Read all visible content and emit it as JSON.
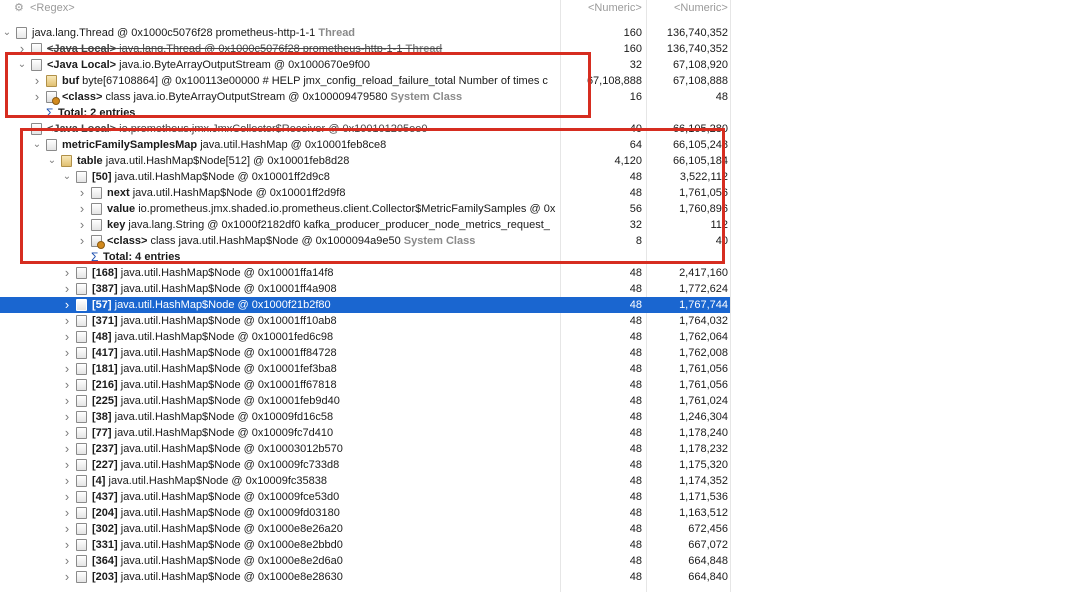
{
  "header": {
    "name_filter": "<Regex>",
    "col1_filter": "<Numeric>",
    "col2_filter": "<Numeric>"
  },
  "rows": [
    {
      "indent": 0,
      "twisty": "v",
      "icon": "thr",
      "bold": "",
      "text": "java.lang.Thread @ 0x1000c5076f28  prometheus-http-1-1",
      "suffix": "Thread",
      "n1": "160",
      "n2": "136,740,352"
    },
    {
      "indent": 1,
      "twisty": ">",
      "icon": "doc",
      "bold": "<Java Local>",
      "text": "java.lang.Thread @ 0x1000c5076f28  prometheus-http-1-1",
      "suffix": "Thread",
      "n1": "160",
      "n2": "136,740,352",
      "strike": true
    },
    {
      "indent": 1,
      "twisty": "v",
      "icon": "doc",
      "bold": "<Java Local>",
      "text": "java.io.ByteArrayOutputStream @ 0x1000670e9f00",
      "suffix": "",
      "n1": "32",
      "n2": "67,108,920"
    },
    {
      "indent": 2,
      "twisty": ">",
      "icon": "arr",
      "bold": "buf",
      "text": "byte[67108864] @ 0x100113e00000  # HELP jmx_config_reload_failure_total Number of times c",
      "suffix": "",
      "n1": "67,108,888",
      "n2": "67,108,888"
    },
    {
      "indent": 2,
      "twisty": ">",
      "icon": "cls",
      "bold": "<class>",
      "text": "class java.io.ByteArrayOutputStream @ 0x100009479580",
      "suffix": "System Class",
      "n1": "16",
      "n2": "48"
    },
    {
      "indent": 2,
      "twisty": "",
      "icon": "sigma",
      "bold": "Total: 2 entries",
      "text": "",
      "suffix": "",
      "n1": "",
      "n2": ""
    },
    {
      "indent": 1,
      "twisty": "v",
      "icon": "doc",
      "bold": "<Java Local>",
      "text": "io.prometheus.jmx.JmxCollector$Receiver @ 0x100101205ee0",
      "suffix": "",
      "n1": "40",
      "n2": "66,105,280",
      "strike": true
    },
    {
      "indent": 2,
      "twisty": "v",
      "icon": "doc",
      "bold": "metricFamilySamplesMap",
      "text": "java.util.HashMap @ 0x10001feb8ce8",
      "suffix": "",
      "n1": "64",
      "n2": "66,105,248"
    },
    {
      "indent": 3,
      "twisty": "v",
      "icon": "arr",
      "bold": "table",
      "text": "java.util.HashMap$Node[512] @ 0x10001feb8d28",
      "suffix": "",
      "n1": "4,120",
      "n2": "66,105,184"
    },
    {
      "indent": 4,
      "twisty": "v",
      "icon": "doc",
      "bold": "[50]",
      "text": "java.util.HashMap$Node @ 0x10001ff2d9c8",
      "suffix": "",
      "n1": "48",
      "n2": "3,522,112"
    },
    {
      "indent": 5,
      "twisty": ">",
      "icon": "doc",
      "bold": "next",
      "text": "java.util.HashMap$Node @ 0x10001ff2d9f8",
      "suffix": "",
      "n1": "48",
      "n2": "1,761,056"
    },
    {
      "indent": 5,
      "twisty": ">",
      "icon": "doc",
      "bold": "value",
      "text": "io.prometheus.jmx.shaded.io.prometheus.client.Collector$MetricFamilySamples @ 0x",
      "suffix": "",
      "n1": "56",
      "n2": "1,760,896"
    },
    {
      "indent": 5,
      "twisty": ">",
      "icon": "doc",
      "bold": "key",
      "text": "java.lang.String @ 0x1000f2182df0  kafka_producer_producer_node_metrics_request_",
      "suffix": "",
      "n1": "32",
      "n2": "112"
    },
    {
      "indent": 5,
      "twisty": ">",
      "icon": "cls",
      "bold": "<class>",
      "text": "class java.util.HashMap$Node @ 0x1000094a9e50",
      "suffix": "System Class",
      "n1": "8",
      "n2": "40"
    },
    {
      "indent": 5,
      "twisty": "",
      "icon": "sigma",
      "bold": "Total: 4 entries",
      "text": "",
      "suffix": "",
      "n1": "",
      "n2": ""
    },
    {
      "indent": 4,
      "twisty": ">",
      "icon": "doc",
      "bold": "[168]",
      "text": "java.util.HashMap$Node @ 0x10001ffa14f8",
      "suffix": "",
      "n1": "48",
      "n2": "2,417,160"
    },
    {
      "indent": 4,
      "twisty": ">",
      "icon": "doc",
      "bold": "[387]",
      "text": "java.util.HashMap$Node @ 0x10001ff4a908",
      "suffix": "",
      "n1": "48",
      "n2": "1,772,624"
    },
    {
      "indent": 4,
      "twisty": ">",
      "icon": "doc",
      "bold": "[57]",
      "text": "java.util.HashMap$Node @ 0x1000f21b2f80",
      "suffix": "",
      "n1": "48",
      "n2": "1,767,744",
      "selected": true
    },
    {
      "indent": 4,
      "twisty": ">",
      "icon": "doc",
      "bold": "[371]",
      "text": "java.util.HashMap$Node @ 0x10001ff10ab8",
      "suffix": "",
      "n1": "48",
      "n2": "1,764,032"
    },
    {
      "indent": 4,
      "twisty": ">",
      "icon": "doc",
      "bold": "[48]",
      "text": "java.util.HashMap$Node @ 0x10001fed6c98",
      "suffix": "",
      "n1": "48",
      "n2": "1,762,064"
    },
    {
      "indent": 4,
      "twisty": ">",
      "icon": "doc",
      "bold": "[417]",
      "text": "java.util.HashMap$Node @ 0x10001ff84728",
      "suffix": "",
      "n1": "48",
      "n2": "1,762,008"
    },
    {
      "indent": 4,
      "twisty": ">",
      "icon": "doc",
      "bold": "[181]",
      "text": "java.util.HashMap$Node @ 0x10001fef3ba8",
      "suffix": "",
      "n1": "48",
      "n2": "1,761,056"
    },
    {
      "indent": 4,
      "twisty": ">",
      "icon": "doc",
      "bold": "[216]",
      "text": "java.util.HashMap$Node @ 0x10001ff67818",
      "suffix": "",
      "n1": "48",
      "n2": "1,761,056"
    },
    {
      "indent": 4,
      "twisty": ">",
      "icon": "doc",
      "bold": "[225]",
      "text": "java.util.HashMap$Node @ 0x10001feb9d40",
      "suffix": "",
      "n1": "48",
      "n2": "1,761,024"
    },
    {
      "indent": 4,
      "twisty": ">",
      "icon": "doc",
      "bold": "[38]",
      "text": "java.util.HashMap$Node @ 0x10009fd16c58",
      "suffix": "",
      "n1": "48",
      "n2": "1,246,304"
    },
    {
      "indent": 4,
      "twisty": ">",
      "icon": "doc",
      "bold": "[77]",
      "text": "java.util.HashMap$Node @ 0x10009fc7d410",
      "suffix": "",
      "n1": "48",
      "n2": "1,178,240"
    },
    {
      "indent": 4,
      "twisty": ">",
      "icon": "doc",
      "bold": "[237]",
      "text": "java.util.HashMap$Node @ 0x10003012b570",
      "suffix": "",
      "n1": "48",
      "n2": "1,178,232"
    },
    {
      "indent": 4,
      "twisty": ">",
      "icon": "doc",
      "bold": "[227]",
      "text": "java.util.HashMap$Node @ 0x10009fc733d8",
      "suffix": "",
      "n1": "48",
      "n2": "1,175,320"
    },
    {
      "indent": 4,
      "twisty": ">",
      "icon": "doc",
      "bold": "[4]",
      "text": "java.util.HashMap$Node @ 0x10009fc35838",
      "suffix": "",
      "n1": "48",
      "n2": "1,174,352"
    },
    {
      "indent": 4,
      "twisty": ">",
      "icon": "doc",
      "bold": "[437]",
      "text": "java.util.HashMap$Node @ 0x10009fce53d0",
      "suffix": "",
      "n1": "48",
      "n2": "1,171,536"
    },
    {
      "indent": 4,
      "twisty": ">",
      "icon": "doc",
      "bold": "[204]",
      "text": "java.util.HashMap$Node @ 0x10009fd03180",
      "suffix": "",
      "n1": "48",
      "n2": "1,163,512"
    },
    {
      "indent": 4,
      "twisty": ">",
      "icon": "doc",
      "bold": "[302]",
      "text": "java.util.HashMap$Node @ 0x1000e8e26a20",
      "suffix": "",
      "n1": "48",
      "n2": "672,456"
    },
    {
      "indent": 4,
      "twisty": ">",
      "icon": "doc",
      "bold": "[331]",
      "text": "java.util.HashMap$Node @ 0x1000e8e2bbd0",
      "suffix": "",
      "n1": "48",
      "n2": "667,072"
    },
    {
      "indent": 4,
      "twisty": ">",
      "icon": "doc",
      "bold": "[364]",
      "text": "java.util.HashMap$Node @ 0x1000e8e2d6a0",
      "suffix": "",
      "n1": "48",
      "n2": "664,848"
    },
    {
      "indent": 4,
      "twisty": ">",
      "icon": "doc",
      "bold": "[203]",
      "text": "java.util.HashMap$Node @ 0x1000e8e28630",
      "suffix": "",
      "n1": "48",
      "n2": "664,840"
    }
  ],
  "colors": {
    "selection": "#1a66d0",
    "highlight_box": "#d62d20"
  }
}
